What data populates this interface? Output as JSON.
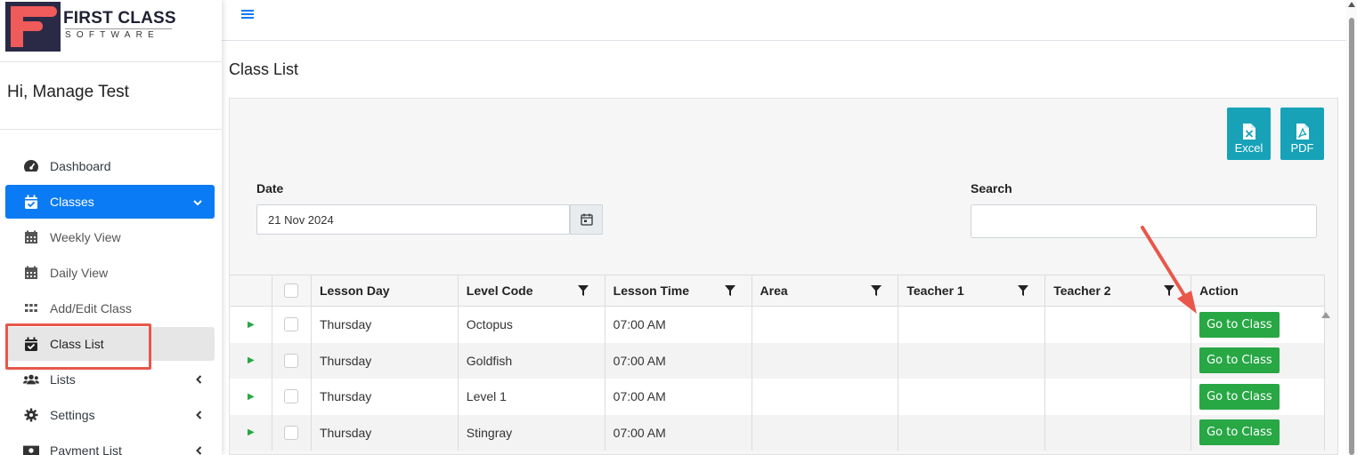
{
  "brand": {
    "name": "FIRST CLASS",
    "tagline": "SOFTWARE"
  },
  "greeting": "Hi, Manage Test",
  "sidebar": {
    "items": [
      {
        "label": "Dashboard",
        "icon": "dashboard-gauge-icon"
      },
      {
        "label": "Classes",
        "icon": "calendar-check-icon",
        "active": true
      },
      {
        "label": "Weekly View",
        "icon": "calendar-grid-icon"
      },
      {
        "label": "Daily View",
        "icon": "calendar-grid-icon"
      },
      {
        "label": "Add/Edit Class",
        "icon": "grid-dots-icon"
      },
      {
        "label": "Class List",
        "icon": "calendar-check-icon",
        "current": true
      },
      {
        "label": "Lists",
        "icon": "users-icon"
      },
      {
        "label": "Settings",
        "icon": "gear-icon"
      },
      {
        "label": "Payment List",
        "icon": "money-icon"
      }
    ]
  },
  "page": {
    "title": "Class List"
  },
  "export": {
    "excel": "Excel",
    "pdf": "PDF"
  },
  "filters": {
    "date_label": "Date",
    "date_value": "21 Nov 2024",
    "search_label": "Search",
    "search_value": ""
  },
  "table": {
    "columns": [
      "Lesson Day",
      "Level Code",
      "Lesson Time",
      "Area",
      "Teacher 1",
      "Teacher 2",
      "Action"
    ],
    "rows": [
      {
        "day": "Thursday",
        "level": "Octopus",
        "time": "07:00 AM",
        "area": "",
        "teacher1": "",
        "teacher2": "",
        "action": "Go to Class"
      },
      {
        "day": "Thursday",
        "level": "Goldfish",
        "time": "07:00 AM",
        "area": "",
        "teacher1": "",
        "teacher2": "",
        "action": "Go to Class"
      },
      {
        "day": "Thursday",
        "level": "Level 1",
        "time": "07:00 AM",
        "area": "",
        "teacher1": "",
        "teacher2": "",
        "action": "Go to Class"
      },
      {
        "day": "Thursday",
        "level": "Stingray",
        "time": "07:00 AM",
        "area": "",
        "teacher1": "",
        "teacher2": "",
        "action": "Go to Class"
      }
    ]
  },
  "colors": {
    "primary": "#0a7bf4",
    "success": "#28a745",
    "info": "#17a2b8",
    "annotation": "#e8574a"
  }
}
